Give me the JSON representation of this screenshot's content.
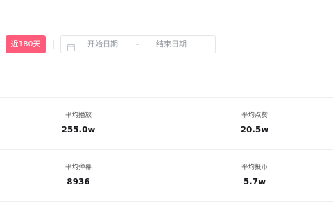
{
  "filter": {
    "range_button": "近180天",
    "start_placeholder": "开始日期",
    "separator": "-",
    "end_placeholder": "结束日期",
    "calendar_icon": "calendar-icon"
  },
  "stats": [
    {
      "label": "平均播放",
      "value": "255.0w"
    },
    {
      "label": "平均点赞",
      "value": "20.5w"
    },
    {
      "label": "平均弹幕",
      "value": "8936"
    },
    {
      "label": "平均投币",
      "value": "5.7w"
    }
  ],
  "colors": {
    "accent": "#ff5c7c",
    "border": "#e3e5e7",
    "placeholder": "#9499a0"
  }
}
